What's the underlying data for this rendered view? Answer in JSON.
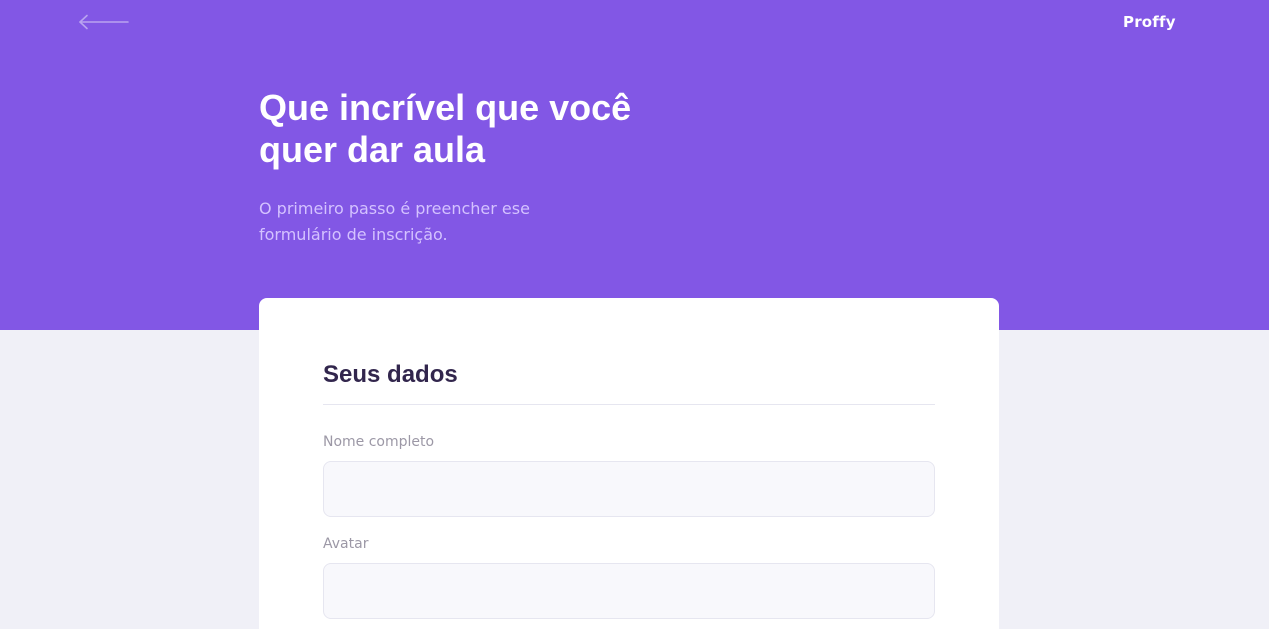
{
  "header": {
    "back_icon": "arrow-left-icon",
    "logo_text": "Proffy"
  },
  "hero": {
    "title": "Que incrível que você quer dar aula",
    "subtitle": "O primeiro passo é preencher ese formulário de inscrição."
  },
  "form": {
    "legend": "Seus dados",
    "fields": [
      {
        "label": "Nome completo",
        "value": "",
        "placeholder": ""
      },
      {
        "label": "Avatar",
        "value": "",
        "placeholder": ""
      }
    ]
  },
  "colors": {
    "primary": "#8257e5",
    "background": "#f0f0f7",
    "card": "#ffffff",
    "title_in_primary": "#ffffff",
    "text_in_primary": "#d4c2ff",
    "text_title": "#32264d",
    "text_label": "#9c98a6",
    "input_background": "#f8f8fc",
    "line": "#e6e6f0"
  }
}
